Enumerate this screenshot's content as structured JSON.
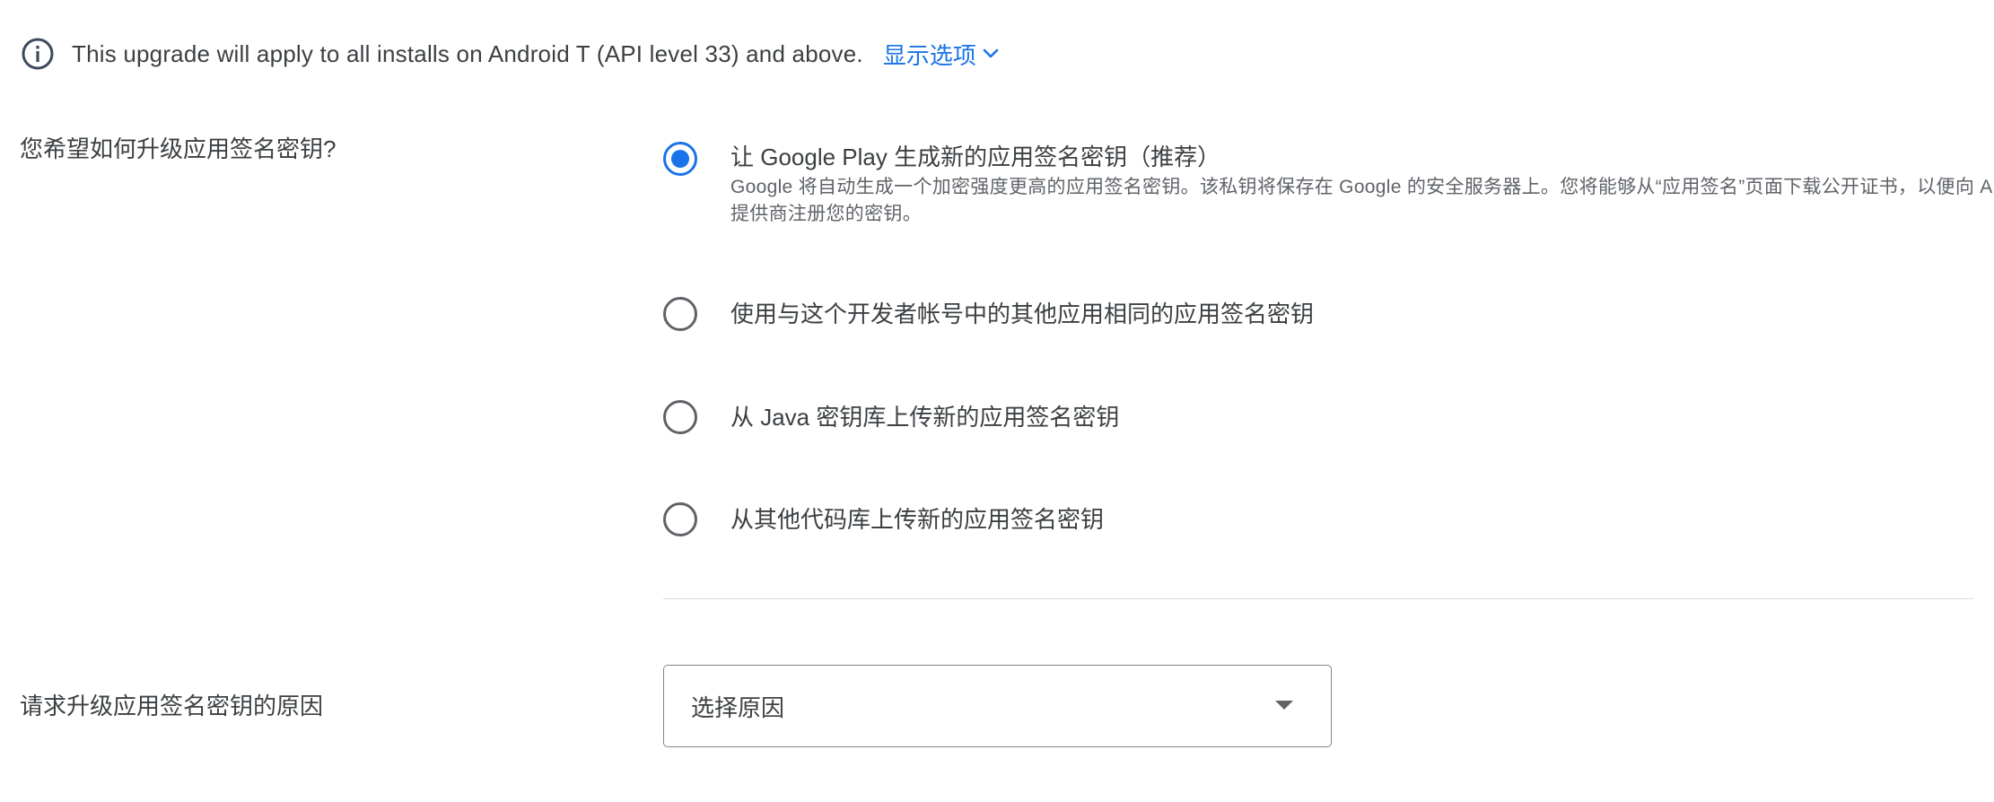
{
  "banner": {
    "icon": "info-icon",
    "text": "This upgrade will apply to all installs on Android T (API level 33) and above.",
    "show_options_label": "显示选项",
    "show_options_icon": "chevron-down-icon"
  },
  "upgrade_question": {
    "label": "您希望如何升级应用签名密钥?",
    "options": [
      {
        "title": "让 Google Play 生成新的应用签名密钥（推荐）",
        "description": "Google 将自动生成一个加密强度更高的应用签名密钥。该私钥将保存在 Google 的安全服务器上。您将能够从“应用签名”页面下载公开证书，以便向 API 提供商注册您的密钥。",
        "selected": true
      },
      {
        "title": "使用与这个开发者帐号中的其他应用相同的应用签名密钥",
        "selected": false
      },
      {
        "title": "从 Java 密钥库上传新的应用签名密钥",
        "selected": false
      },
      {
        "title": "从其他代码库上传新的应用签名密钥",
        "selected": false
      }
    ]
  },
  "reason": {
    "label": "请求升级应用签名密钥的原因",
    "select_value": "选择原因",
    "select_icon": "dropdown-arrow-icon"
  },
  "colors": {
    "accent": "#1a73e8",
    "text": "#3c4043",
    "secondary_text": "#5f6368",
    "divider": "#dadce0"
  }
}
